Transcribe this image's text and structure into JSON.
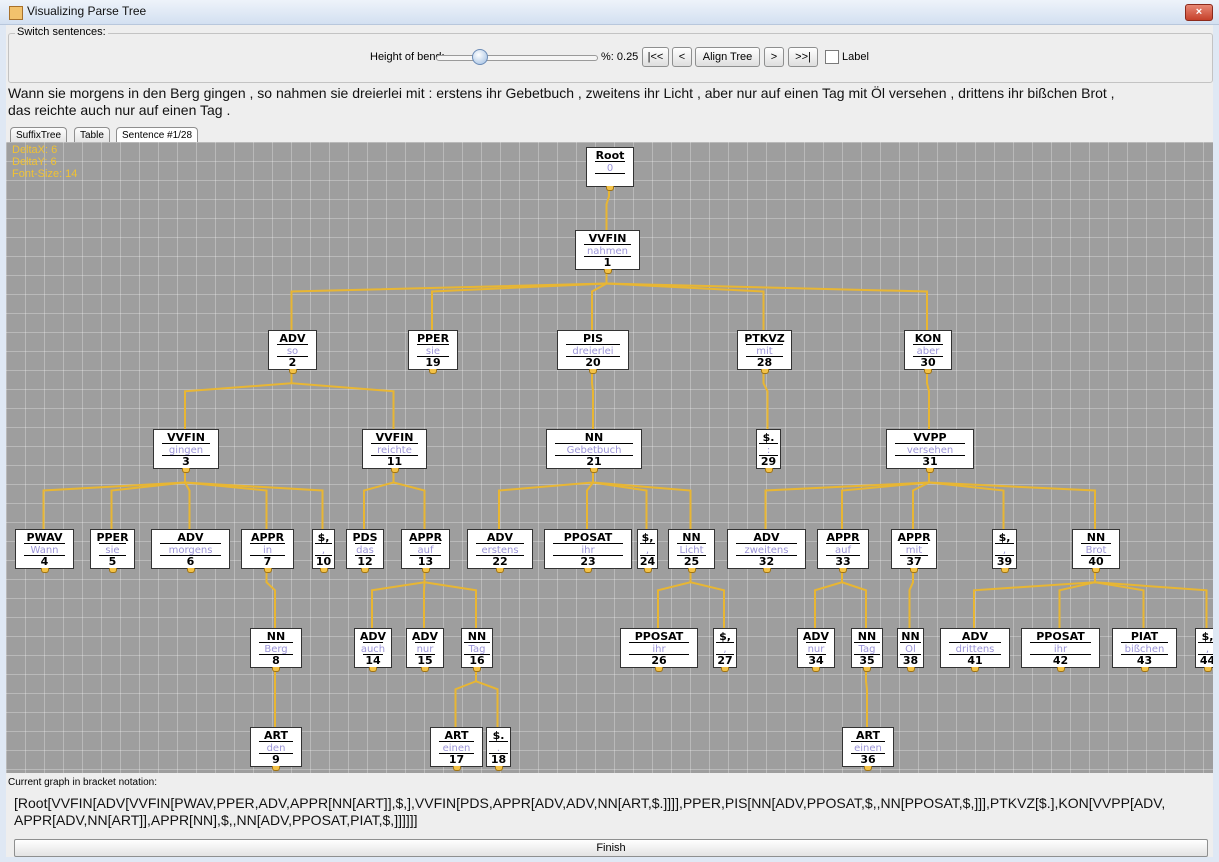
{
  "window": {
    "title": "Visualizing Parse Tree",
    "close_label": "×"
  },
  "switch_panel": {
    "legend": "Switch sentences:",
    "bend_label": "Height of bend:",
    "bend_value": 0.25,
    "percent_label": "%: 0.25",
    "first_label": "|<<",
    "prev_label": "<",
    "align_label": "Align Tree",
    "next_label": ">",
    "last_label": ">>|",
    "label_checkbox": "Label",
    "label_checked": false
  },
  "sentence_line1": "Wann sie morgens in den Berg gingen , so nahmen sie dreierlei mit : erstens ihr Gebetbuch , zweitens ihr Licht , aber nur auf einen Tag mit Öl versehen , drittens ihr bißchen Brot ,",
  "sentence_line2": "das reichte auch nur auf einen Tag .",
  "tabs": [
    "SuffixTree",
    "Table",
    "Sentence #1/28"
  ],
  "info": {
    "deltax": "DeltaX: 6",
    "deltay": "DeltaY: 6",
    "fontsize": "Font-Size: 14"
  },
  "nodes": [
    {
      "tag": "Root",
      "word": "0",
      "id": ""
    },
    {
      "tag": "VVFIN",
      "word": "nahmen",
      "id": "1"
    },
    {
      "tag": "ADV",
      "word": "so",
      "id": "2"
    },
    {
      "tag": "PPER",
      "word": "sie",
      "id": "19"
    },
    {
      "tag": "PIS",
      "word": "dreierlei",
      "id": "20"
    },
    {
      "tag": "PTKVZ",
      "word": "mit",
      "id": "28"
    },
    {
      "tag": "KON",
      "word": "aber",
      "id": "30"
    },
    {
      "tag": "VVFIN",
      "word": "gingen",
      "id": "3"
    },
    {
      "tag": "VVFIN",
      "word": "reichte",
      "id": "11"
    },
    {
      "tag": "NN",
      "word": "Gebetbuch",
      "id": "21"
    },
    {
      "tag": "$.",
      "word": ":",
      "id": "29"
    },
    {
      "tag": "VVPP",
      "word": "versehen",
      "id": "31"
    },
    {
      "tag": "PWAV",
      "word": "Wann",
      "id": "4"
    },
    {
      "tag": "PPER",
      "word": "sie",
      "id": "5"
    },
    {
      "tag": "ADV",
      "word": "morgens",
      "id": "6"
    },
    {
      "tag": "APPR",
      "word": "in",
      "id": "7"
    },
    {
      "tag": "$,",
      "word": ",",
      "id": "10"
    },
    {
      "tag": "PDS",
      "word": "das",
      "id": "12"
    },
    {
      "tag": "APPR",
      "word": "auf",
      "id": "13"
    },
    {
      "tag": "ADV",
      "word": "erstens",
      "id": "22"
    },
    {
      "tag": "PPOSAT",
      "word": "ihr",
      "id": "23"
    },
    {
      "tag": "$,",
      "word": ",",
      "id": "24"
    },
    {
      "tag": "NN",
      "word": "Licht",
      "id": "25"
    },
    {
      "tag": "ADV",
      "word": "zweitens",
      "id": "32"
    },
    {
      "tag": "APPR",
      "word": "auf",
      "id": "33"
    },
    {
      "tag": "APPR",
      "word": "mit",
      "id": "37"
    },
    {
      "tag": "$,",
      "word": ",",
      "id": "39"
    },
    {
      "tag": "NN",
      "word": "Brot",
      "id": "40"
    },
    {
      "tag": "NN",
      "word": "Berg",
      "id": "8"
    },
    {
      "tag": "ADV",
      "word": "auch",
      "id": "14"
    },
    {
      "tag": "ADV",
      "word": "nur",
      "id": "15"
    },
    {
      "tag": "NN",
      "word": "Tag",
      "id": "16"
    },
    {
      "tag": "PPOSAT",
      "word": "ihr",
      "id": "26"
    },
    {
      "tag": "$,",
      "word": ",",
      "id": "27"
    },
    {
      "tag": "ADV",
      "word": "nur",
      "id": "34"
    },
    {
      "tag": "NN",
      "word": "Tag",
      "id": "35"
    },
    {
      "tag": "NN",
      "word": "Öl",
      "id": "38"
    },
    {
      "tag": "ADV",
      "word": "drittens",
      "id": "41"
    },
    {
      "tag": "PPOSAT",
      "word": "ihr",
      "id": "42"
    },
    {
      "tag": "PIAT",
      "word": "bißchen",
      "id": "43"
    },
    {
      "tag": "$,",
      "word": ",",
      "id": "44"
    },
    {
      "tag": "ART",
      "word": "den",
      "id": "9"
    },
    {
      "tag": "ART",
      "word": "einen",
      "id": "17"
    },
    {
      "tag": "$.",
      "word": ".",
      "id": "18"
    },
    {
      "tag": "ART",
      "word": "einen",
      "id": "36"
    }
  ],
  "bracket_label": "Current graph in bracket notation:",
  "bracket_line1": "[Root[VVFIN[ADV[VVFIN[PWAV,PPER,ADV,APPR[NN[ART]],$,],VVFIN[PDS,APPR[ADV,ADV,NN[ART,$.]]]],PPER,PIS[NN[ADV,PPOSAT,$,,NN[PPOSAT,$,]]],PTKVZ[$.],KON[VVPP[ADV,",
  "bracket_line2": "APPR[ADV,NN[ART]],APPR[NN],$,,NN[ADV,PPOSAT,PIAT,$,]]]]]]",
  "finish_label": "Finish",
  "colors": {
    "edge": "#e8b633",
    "canvas": "#9e9e9e",
    "word": "#9c95d8",
    "info": "#f1c232"
  }
}
